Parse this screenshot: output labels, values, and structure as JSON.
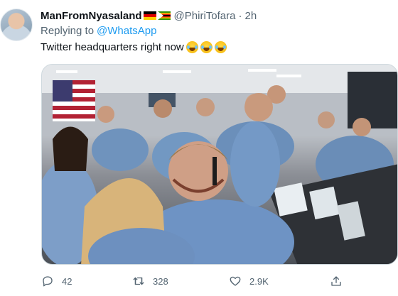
{
  "tweet": {
    "display_name": "ManFromNyasaland",
    "flags": [
      "flag-germany-icon",
      "flag-zimbabwe-icon"
    ],
    "handle": "@PhiriTofara",
    "separator": "·",
    "time": "2h",
    "replying_prefix": "Replying to",
    "replying_to": "@WhatsApp",
    "text": "Twitter headquarters right now",
    "emojis": [
      "face-with-tears-of-joy-icon",
      "face-with-tears-of-joy-icon",
      "face-with-tears-of-joy-icon"
    ],
    "media_alt": "Mission control room with staff cheering and hugging"
  },
  "actions": {
    "reply_count": "42",
    "retweet_count": "328",
    "like_count": "2.9K"
  },
  "colors": {
    "text_primary": "#0f1419",
    "text_secondary": "#536471",
    "link": "#1d9bf0",
    "border": "#cfd9de"
  }
}
